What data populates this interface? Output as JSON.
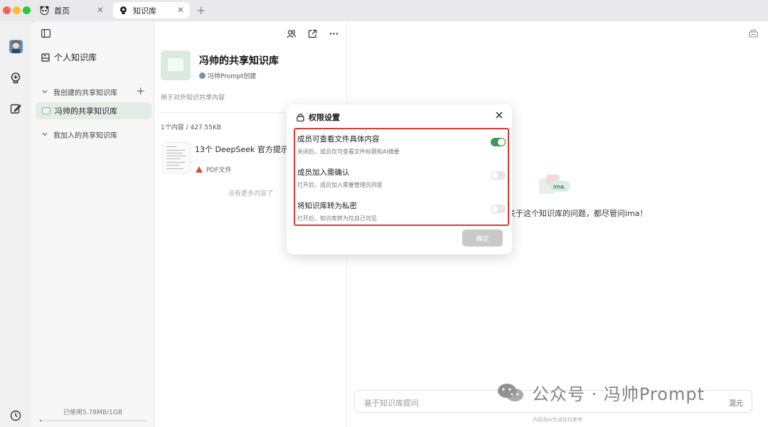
{
  "tabs": [
    {
      "label": "首页",
      "close": "✕"
    },
    {
      "label": "知识库",
      "close": "✕"
    }
  ],
  "tab_add": "+",
  "sidebar": {
    "personal_label": "个人知识库",
    "created_section": "我创建的共享知识库",
    "active_item": "冯帅的共享知识库",
    "joined_section": "我加入的共享知识库",
    "usage_text": "已使用5.78MB/1GB",
    "usage_fraction": 0.0056,
    "plus": "+"
  },
  "kb": {
    "title": "冯帅的共享知识库",
    "author": "冯帅Prompt创建",
    "description": "用于对外知识共享内容",
    "count_text": "1个内容 / 427.55KB",
    "file_name": "13个 DeepSeek 官方提示词",
    "file_type": "PDF文件",
    "no_more": "没有更多内容了"
  },
  "right": {
    "logo_text": "ima.",
    "hint": "关于这个知识库的问题，都尽管问ima！",
    "ask_placeholder": "基于知识库提问",
    "model_label": "混元",
    "ai_note": "内容由AI生成仅供参考",
    "watermark": "公众号 · 冯帅Prompt"
  },
  "modal": {
    "title": "权限设置",
    "items": [
      {
        "title": "成员可查看文件具体内容",
        "desc": "关闭后，成员仅可查看文件标题和AI摘要",
        "enabled": true
      },
      {
        "title": "成员加入需确认",
        "desc": "打开后，成员加入需要管理员同意",
        "enabled": false
      },
      {
        "title": "将知识库转为私密",
        "desc": "打开后，知识库转为仅自己可见",
        "enabled": false
      }
    ],
    "confirm_label": "确定"
  },
  "colors": {
    "accent_green": "#3a9a4f",
    "highlight_red": "#d93a35",
    "pdf_red": "#e1453b"
  }
}
